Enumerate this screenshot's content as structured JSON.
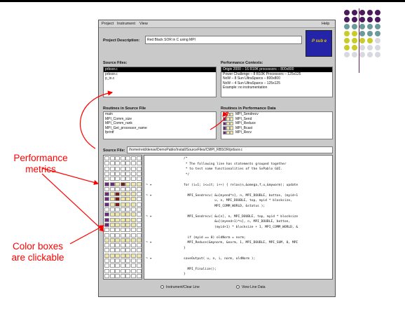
{
  "window": {
    "menu": [
      "Project",
      "Instrument",
      "View"
    ],
    "help": "Help",
    "project_label": "Project Description:",
    "project_value": "Red Black SOR in C using MPI",
    "logo_text": "P sub e",
    "source_files_label": "Source Files:",
    "source_files": [
      "prbsor.c",
      "prbsor.c",
      "p_io.c"
    ],
    "contexts_label": "Performance Contexts:",
    "contexts": [
      "Origin 2000 – 16 R10K processors – 800x800",
      "Power Challenge – 8 R10K Processors – 125x125",
      "NoW – 8 Sun UltraSparcs – 800x800",
      "NoW – 4 Sun UltraSparcs – 125x125",
      "Example: no instrumentation"
    ],
    "routines_label": "Routines in Source File",
    "routines": [
      "main",
      "MPI_Comm_size",
      "MPI_Comm_rank",
      "MPI_Get_processor_name",
      "fprintf"
    ],
    "perf_routines_label": "Routines in Performance Data",
    "perf_routines": [
      "MPI_Sendrecv",
      "MPI_Send",
      "MPI_Reduce",
      "MPI_Bcast",
      "MPI_Recv"
    ],
    "source_file_label": "Source File:",
    "source_file_path": "/home/reid/dense/DemoPablo/Install/SourceFiles/CMPI_RBSOR/prbsor.c",
    "code_lines": [
      "/*",
      " * The following line has statements grouped together",
      " * to test some functionalities of the SvPablo GUI.",
      " */",
      "",
      "for (i=1; i<=it; i++) { relax(n,&omega,f,u,&myworm); update",
      "",
      "  MPI_Sendrecv( &u[myend*n], n, MPI_DOUBLE, botton, (myid+1",
      "                u, n, MPI_DOUBLE, top, myid * blocksize,",
      "                MPI_COMM_WORLD, &status );",
      "",
      "  MPI_Sendrecv( &u[n], n, MPI_DOUBLE, top, myid * blocksize",
      "                &u[(myend+1)*n], n, MPI_DOUBLE, botton,",
      "                (myid+1) * blocksize + 1, MPI_COMM_WORLD, &",
      "",
      "  if (myid == 0) oldNorm = norm;",
      "  MPI_Reduce(&mynorm, &norm, 1, MPI_DOUBLE, MPI_SUM, 0, MPI",
      "}",
      "",
      "saveOutput( u, n, i, norm, oldNorm );",
      "",
      "  MPI_Finalize();",
      "}"
    ],
    "bottom_left": "Instrument/Clear Line",
    "bottom_right": "View Line Data"
  },
  "annotations": {
    "metrics": [
      "Performance",
      "metrics"
    ],
    "clickable": [
      "Color boxes",
      "are clickable"
    ]
  },
  "colors": {
    "accent_red": "#ff0000",
    "logo_blue": "#2424a8",
    "metric_purple": "#6b2a7a",
    "metric_brown": "#7a1f14",
    "metric_yellow": "#f3e9a6"
  }
}
